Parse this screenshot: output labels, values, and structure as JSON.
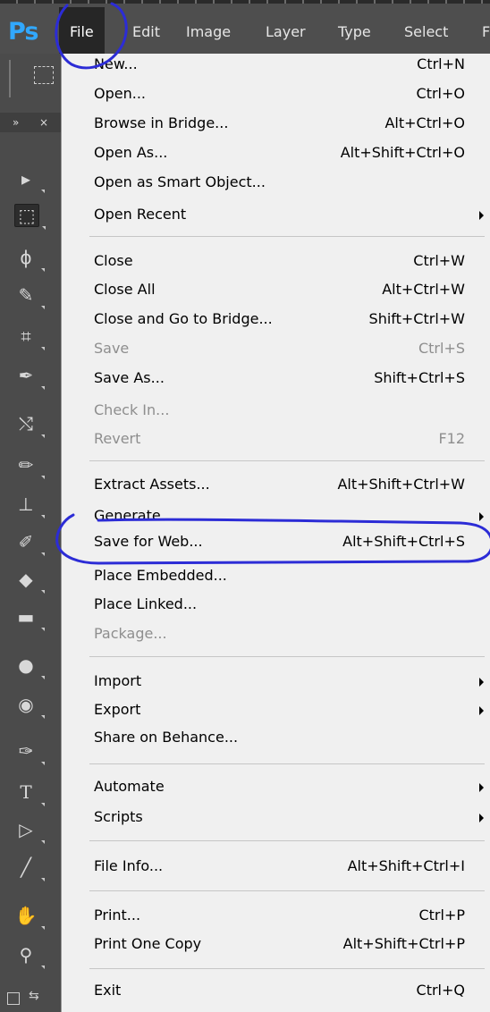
{
  "app": {
    "logo": "Ps"
  },
  "menubar": {
    "items": [
      "File",
      "Edit",
      "Image",
      "Layer",
      "Type",
      "Select",
      "F"
    ]
  },
  "file_menu": {
    "items": [
      {
        "label": "New...",
        "shortcut": "Ctrl+N",
        "enabled": true
      },
      {
        "label": "Open...",
        "shortcut": "Ctrl+O",
        "enabled": true
      },
      {
        "label": "Browse in Bridge...",
        "shortcut": "Alt+Ctrl+O",
        "enabled": true
      },
      {
        "label": "Open As...",
        "shortcut": "Alt+Shift+Ctrl+O",
        "enabled": true
      },
      {
        "label": "Open as Smart Object...",
        "shortcut": "",
        "enabled": true
      },
      {
        "label": "Open Recent",
        "shortcut": "",
        "enabled": true,
        "submenu": true
      },
      {
        "label": "Close",
        "shortcut": "Ctrl+W",
        "enabled": true
      },
      {
        "label": "Close All",
        "shortcut": "Alt+Ctrl+W",
        "enabled": true
      },
      {
        "label": "Close and Go to Bridge...",
        "shortcut": "Shift+Ctrl+W",
        "enabled": true
      },
      {
        "label": "Save",
        "shortcut": "Ctrl+S",
        "enabled": false
      },
      {
        "label": "Save As...",
        "shortcut": "Shift+Ctrl+S",
        "enabled": true
      },
      {
        "label": "Check In...",
        "shortcut": "",
        "enabled": false
      },
      {
        "label": "Revert",
        "shortcut": "F12",
        "enabled": false
      },
      {
        "label": "Extract Assets...",
        "shortcut": "Alt+Shift+Ctrl+W",
        "enabled": true
      },
      {
        "label": "Generate",
        "shortcut": "",
        "enabled": true,
        "submenu": true
      },
      {
        "label": "Save for Web...",
        "shortcut": "Alt+Shift+Ctrl+S",
        "enabled": true
      },
      {
        "label": "Place Embedded...",
        "shortcut": "",
        "enabled": true
      },
      {
        "label": "Place Linked...",
        "shortcut": "",
        "enabled": true
      },
      {
        "label": "Package...",
        "shortcut": "",
        "enabled": false
      },
      {
        "label": "Import",
        "shortcut": "",
        "enabled": true,
        "submenu": true
      },
      {
        "label": "Export",
        "shortcut": "",
        "enabled": true,
        "submenu": true
      },
      {
        "label": "Share on Behance...",
        "shortcut": "",
        "enabled": true
      },
      {
        "label": "Automate",
        "shortcut": "",
        "enabled": true,
        "submenu": true
      },
      {
        "label": "Scripts",
        "shortcut": "",
        "enabled": true,
        "submenu": true
      },
      {
        "label": "File Info...",
        "shortcut": "Alt+Shift+Ctrl+I",
        "enabled": true
      },
      {
        "label": "Print...",
        "shortcut": "Ctrl+P",
        "enabled": true
      },
      {
        "label": "Print One Copy",
        "shortcut": "Alt+Shift+Ctrl+P",
        "enabled": true
      },
      {
        "label": "Exit",
        "shortcut": "Ctrl+Q",
        "enabled": true
      }
    ]
  },
  "toolbar": {
    "tools": [
      {
        "icon": "move-tool-icon",
        "glyph": "▸"
      },
      {
        "icon": "marquee-tool-icon",
        "glyph": "⬚"
      },
      {
        "icon": "lasso-tool-icon",
        "glyph": "ϕ"
      },
      {
        "icon": "quick-selection-tool-icon",
        "glyph": "✎"
      },
      {
        "icon": "crop-tool-icon",
        "glyph": "⌗"
      },
      {
        "icon": "eyedropper-tool-icon",
        "glyph": "✒"
      },
      {
        "icon": "healing-brush-tool-icon",
        "glyph": "⤭"
      },
      {
        "icon": "brush-tool-icon",
        "glyph": "✏"
      },
      {
        "icon": "clone-stamp-tool-icon",
        "glyph": "⊥"
      },
      {
        "icon": "history-brush-tool-icon",
        "glyph": "✐"
      },
      {
        "icon": "eraser-tool-icon",
        "glyph": "◆"
      },
      {
        "icon": "gradient-tool-icon",
        "glyph": "▬"
      },
      {
        "icon": "blur-tool-icon",
        "glyph": "●"
      },
      {
        "icon": "dodge-tool-icon",
        "glyph": "◉"
      },
      {
        "icon": "pen-tool-icon",
        "glyph": "✑"
      },
      {
        "icon": "type-tool-icon",
        "glyph": "T"
      },
      {
        "icon": "path-selection-tool-icon",
        "glyph": "▷"
      },
      {
        "icon": "line-tool-icon",
        "glyph": "╱"
      },
      {
        "icon": "hand-tool-icon",
        "glyph": "✋"
      },
      {
        "icon": "zoom-tool-icon",
        "glyph": "⚲"
      }
    ]
  },
  "colors": {
    "menubar_bg": "#4e4e4e",
    "menu_bg": "#f0f0f0",
    "active_menu_bg": "#262626",
    "annotation": "#2c2cd6",
    "ps_blue": "#31a8ff"
  }
}
